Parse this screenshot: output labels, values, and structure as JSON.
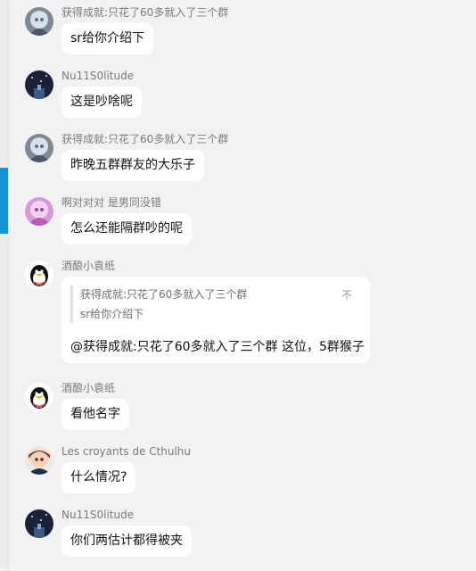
{
  "messages": [
    {
      "sender": "获得成就:只花了60多就入了三个群",
      "avatar": "silver-hair-avatar",
      "text": "sr给你介绍下"
    },
    {
      "sender": "Nu11S0litude",
      "avatar": "night-sky-avatar",
      "text": "这是吵啥呢"
    },
    {
      "sender": "获得成就:只花了60多就入了三个群",
      "avatar": "silver-hair-avatar",
      "text": "昨晚五群群友的大乐子"
    },
    {
      "sender": "啊对对对 是男同没错",
      "avatar": "pink-hair-avatar",
      "text": "怎么还能隔群吵的呢"
    },
    {
      "sender": "酒酿小袁纸",
      "avatar": "qq-penguin-avatar",
      "quote": {
        "name": "获得成就:只花了60多就入了三个群",
        "text": "sr给你介绍下",
        "mark": "不"
      },
      "mention": "@获得成就:只花了60多就入了三个群",
      "text": "这位，5群猴子"
    },
    {
      "sender": "酒酿小袁纸",
      "avatar": "qq-penguin-avatar",
      "text": "看他名字"
    },
    {
      "sender": "Les croyants de Cthulhu",
      "avatar": "brown-hair-avatar",
      "text": "什么情况?"
    },
    {
      "sender": "Nu11S0litude",
      "avatar": "night-sky-avatar",
      "text": "你们两估计都得被夹"
    }
  ]
}
